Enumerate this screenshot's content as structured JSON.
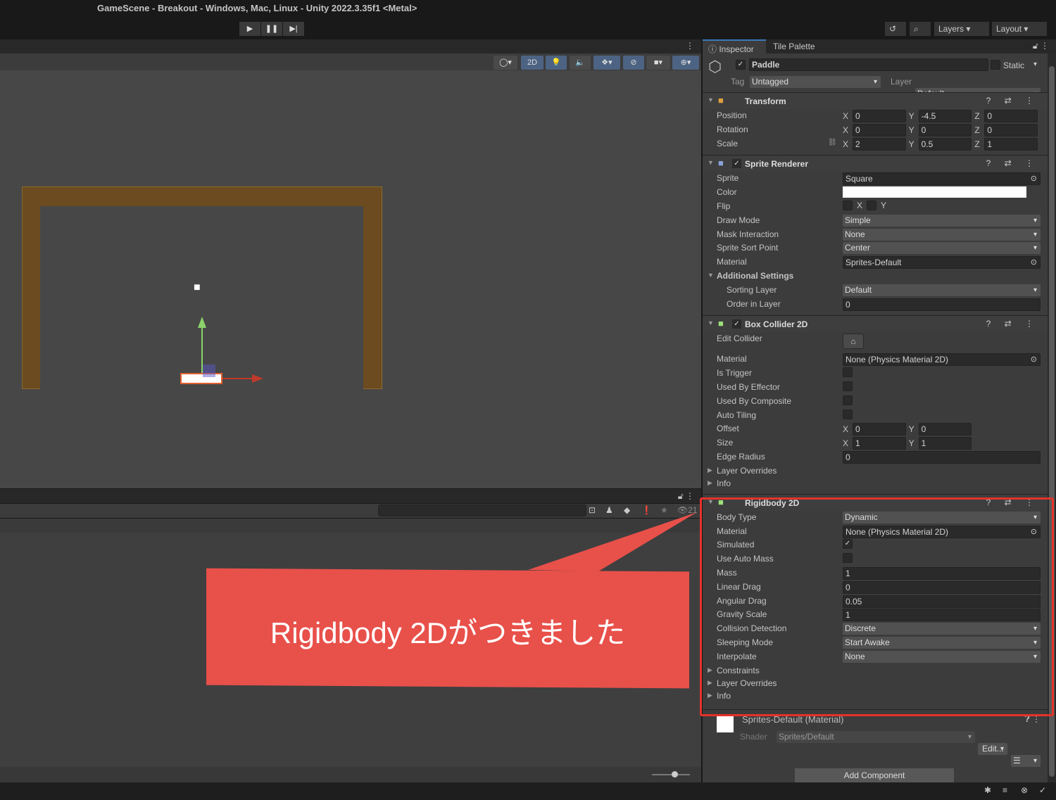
{
  "window": {
    "title": "GameScene - Breakout - Windows, Mac, Linux - Unity 2022.3.35f1 <Metal>"
  },
  "toolbar": {
    "play": "▶",
    "pause": "❚❚",
    "step": "▶|",
    "history_icon": "history-icon",
    "search_icon": "search-icon",
    "layers": "Layers",
    "layout": "Layout"
  },
  "scene_toolbar": {
    "mode_2d": "2D"
  },
  "bottom": {
    "search_placeholder": "",
    "hidden_count": "21"
  },
  "inspector": {
    "tabs": [
      "Inspector",
      "Tile Palette"
    ],
    "object": {
      "name": "Paddle",
      "active": true,
      "static_label": "Static",
      "tag_label": "Tag",
      "tag": "Untagged",
      "layer_label": "Layer",
      "layer": "Default"
    },
    "components": [
      {
        "name": "Transform",
        "icon": "transform-icon",
        "color": "#e0a040",
        "checkbox": false,
        "rows": [
          {
            "label": "Position",
            "type": "vec",
            "values": [
              [
                "X",
                "0"
              ],
              [
                "Y",
                "-4.5"
              ],
              [
                "Z",
                "0"
              ]
            ]
          },
          {
            "label": "Rotation",
            "type": "vec",
            "values": [
              [
                "X",
                "0"
              ],
              [
                "Y",
                "0"
              ],
              [
                "Z",
                "0"
              ]
            ]
          },
          {
            "label": "Scale",
            "type": "vec",
            "values": [
              [
                "X",
                "2"
              ],
              [
                "Y",
                "0.5"
              ],
              [
                "Z",
                "1"
              ]
            ]
          }
        ]
      },
      {
        "name": "Sprite Renderer",
        "icon": "sprite-renderer-icon",
        "color": "#8aa0d8",
        "checkbox": true,
        "rows": [
          {
            "label": "Sprite",
            "type": "object",
            "value": "Square"
          },
          {
            "label": "Color",
            "type": "color",
            "value": "#ffffff"
          },
          {
            "label": "Flip",
            "type": "flip",
            "values": [
              "X",
              "Y"
            ]
          },
          {
            "label": "Draw Mode",
            "type": "dropdown",
            "value": "Simple"
          },
          {
            "label": "Mask Interaction",
            "type": "dropdown",
            "value": "None"
          },
          {
            "label": "Sprite Sort Point",
            "type": "dropdown",
            "value": "Center"
          },
          {
            "label": "Material",
            "type": "object",
            "value": "Sprites-Default"
          },
          {
            "label": "Additional Settings",
            "type": "foldout-open"
          },
          {
            "label": "Sorting Layer",
            "type": "dropdown",
            "value": "Default",
            "indent": true
          },
          {
            "label": "Order in Layer",
            "type": "text",
            "value": "0",
            "indent": true
          }
        ]
      },
      {
        "name": "Box Collider 2D",
        "icon": "box-collider-icon",
        "color": "#9be07a",
        "checkbox": true,
        "rows": [
          {
            "label": "Edit Collider",
            "type": "button",
            "value": "edit-collider-icon"
          },
          {
            "label": "Material",
            "type": "object",
            "value": "None (Physics Material 2D)"
          },
          {
            "label": "Is Trigger",
            "type": "check",
            "value": false
          },
          {
            "label": "Used By Effector",
            "type": "check",
            "value": false
          },
          {
            "label": "Used By Composite",
            "type": "check",
            "value": false
          },
          {
            "label": "Auto Tiling",
            "type": "check",
            "value": false
          },
          {
            "label": "Offset",
            "type": "vec2",
            "values": [
              [
                "X",
                "0"
              ],
              [
                "Y",
                "0"
              ]
            ]
          },
          {
            "label": "Size",
            "type": "vec2",
            "values": [
              [
                "X",
                "1"
              ],
              [
                "Y",
                "1"
              ]
            ]
          },
          {
            "label": "Edge Radius",
            "type": "text",
            "value": "0"
          },
          {
            "label": "Layer Overrides",
            "type": "foldout"
          },
          {
            "label": "Info",
            "type": "foldout"
          }
        ]
      },
      {
        "name": "Rigidbody 2D",
        "icon": "rigidbody-icon",
        "color": "#9be07a",
        "checkbox": false,
        "rows": [
          {
            "label": "Body Type",
            "type": "dropdown",
            "value": "Dynamic"
          },
          {
            "label": "Material",
            "type": "object",
            "value": "None (Physics Material 2D)"
          },
          {
            "label": "Simulated",
            "type": "check",
            "value": true
          },
          {
            "label": "Use Auto Mass",
            "type": "check",
            "value": false
          },
          {
            "label": "Mass",
            "type": "text",
            "value": "1"
          },
          {
            "label": "Linear Drag",
            "type": "text",
            "value": "0"
          },
          {
            "label": "Angular Drag",
            "type": "text",
            "value": "0.05"
          },
          {
            "label": "Gravity Scale",
            "type": "text",
            "value": "1"
          },
          {
            "label": "Collision Detection",
            "type": "dropdown",
            "value": "Discrete"
          },
          {
            "label": "Sleeping Mode",
            "type": "dropdown",
            "value": "Start Awake"
          },
          {
            "label": "Interpolate",
            "type": "dropdown",
            "value": "None"
          },
          {
            "label": "Constraints",
            "type": "foldout"
          },
          {
            "label": "Layer Overrides",
            "type": "foldout"
          },
          {
            "label": "Info",
            "type": "foldout"
          }
        ]
      }
    ],
    "material": {
      "title": "Sprites-Default (Material)",
      "shader_label": "Shader",
      "shader": "Sprites/Default",
      "edit": "Edit..."
    },
    "add_component": "Add Component"
  },
  "callout": {
    "text": "Rigidbody 2Dがつきました",
    "color": "#e8504a"
  }
}
